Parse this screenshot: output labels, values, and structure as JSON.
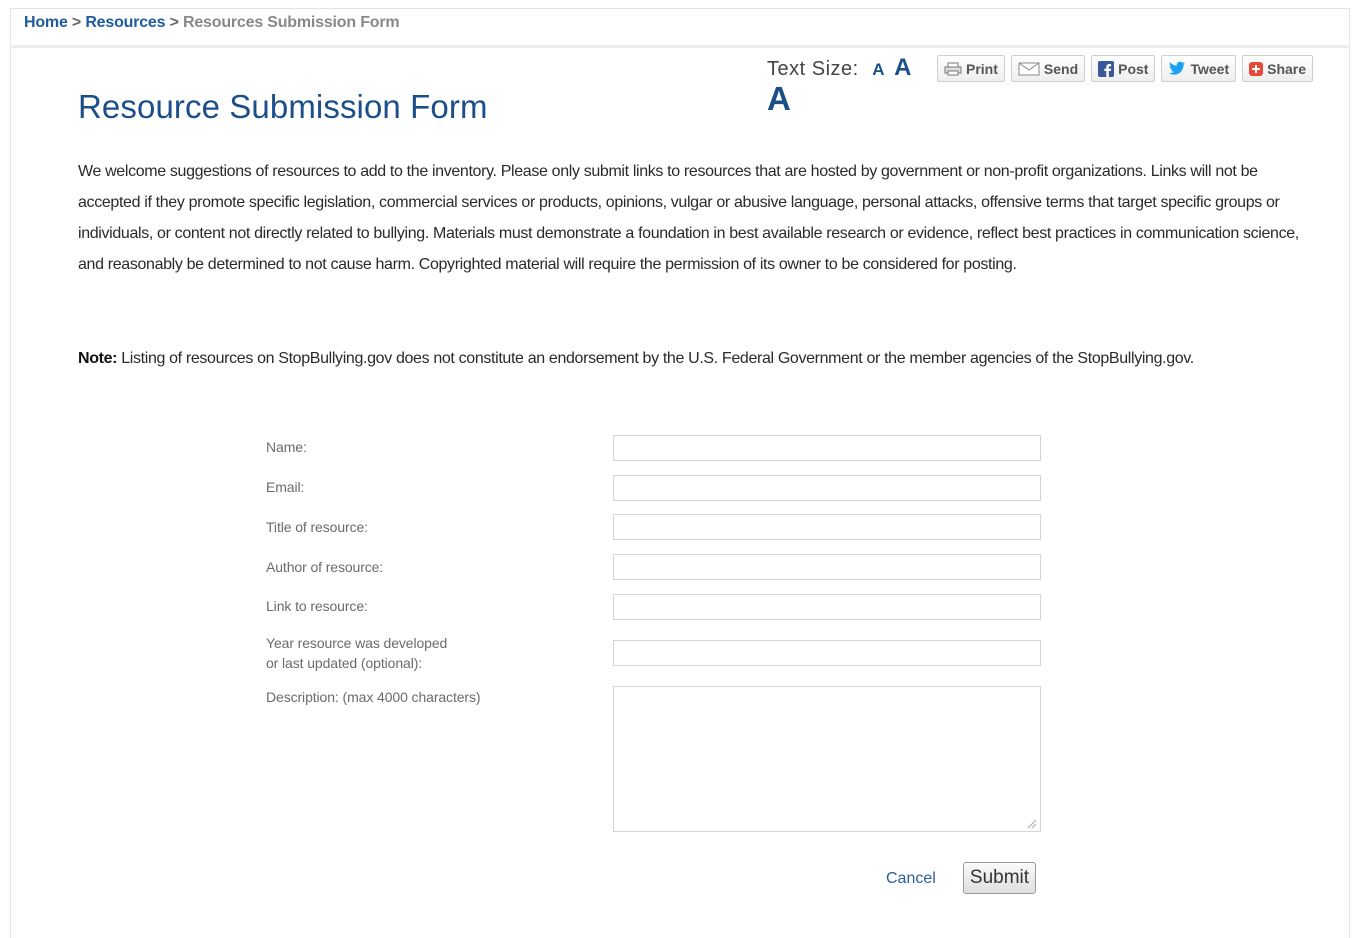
{
  "breadcrumb": {
    "home": "Home",
    "separator": ">",
    "resources": "Resources",
    "current": "Resources Submission Form"
  },
  "page": {
    "title": "Resource Submission Form"
  },
  "text_size": {
    "label": "Text Size:",
    "options": [
      "A",
      "A",
      "A"
    ]
  },
  "share": {
    "print": "Print",
    "send": "Send",
    "post": "Post",
    "tweet": "Tweet",
    "share": "Share"
  },
  "content": {
    "intro": "We welcome suggestions of resources to add to the inventory. Please only submit links to resources that are hosted by government or non-profit organizations. Links will not be accepted if they promote specific legislation, commercial services or products, opinions, vulgar or abusive language, personal attacks, offensive terms that target specific groups or individuals, or content not directly related to bullying. Materials must demonstrate a foundation in best available research or evidence, reflect best practices in communication science, and reasonably be determined to not cause harm. Copyrighted material will require the permission of its owner to be considered for posting.",
    "note_label": "Note:",
    "note_text": " Listing of resources on StopBullying.gov does not constitute an endorsement by the U.S. Federal Government or the member agencies of the StopBullying.gov."
  },
  "form": {
    "name_label": "Name:",
    "email_label": "Email:",
    "title_label": "Title of resource:",
    "author_label": "Author of resource:",
    "link_label": "Link to resource:",
    "year_label_line1": "Year resource was developed",
    "year_label_line2": "or last updated (optional):",
    "description_label": "Description: (max 4000 characters)",
    "name_value": "",
    "email_value": "",
    "title_value": "",
    "author_value": "",
    "link_value": "",
    "year_value": "",
    "description_value": "",
    "cancel_label": "Cancel",
    "submit_label": "Submit"
  },
  "colors": {
    "title": "#1c4f8a",
    "link": "#1f5b9b",
    "facebook": "#3b5998",
    "twitter": "#1da1f2",
    "share_icon": "#e8493a"
  }
}
